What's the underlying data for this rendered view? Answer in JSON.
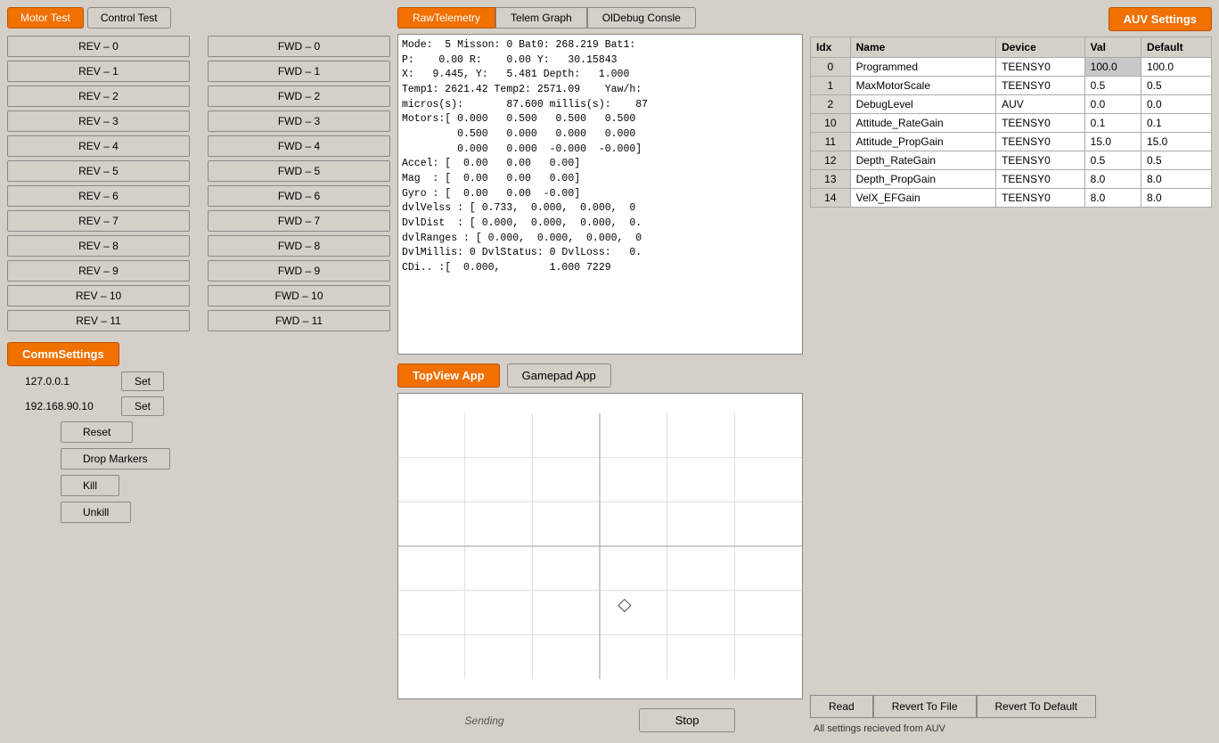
{
  "tabs_left": {
    "motor_test": "Motor Test",
    "control_test": "Control Test"
  },
  "motor_buttons": {
    "rev": [
      "REV – 0",
      "REV – 1",
      "REV – 2",
      "REV – 3",
      "REV – 4",
      "REV – 5",
      "REV – 6",
      "REV – 7",
      "REV – 8",
      "REV – 9",
      "REV – 10",
      "REV – 11"
    ],
    "fwd": [
      "FWD – 0",
      "FWD – 1",
      "FWD – 2",
      "FWD – 3",
      "FWD – 4",
      "FWD – 5",
      "FWD – 6",
      "FWD – 7",
      "FWD – 8",
      "FWD – 9",
      "FWD – 10",
      "FWD – 11"
    ]
  },
  "comm": {
    "label": "CommSettings",
    "ip1": "127.0.0.1",
    "ip2": "192.168.90.10",
    "set1": "Set",
    "set2": "Set",
    "reset": "Reset",
    "drop_markers": "Drop Markers",
    "kill": "Kill",
    "unkill": "Unkill"
  },
  "middle_tabs": {
    "raw_telemetry": "RawTelemetry",
    "telem_graph": "Telem Graph",
    "ol_debug": "OlDebug Consle"
  },
  "telemetry_text": "Mode:  5 Misson: 0 Bat0: 268.219 Bat1: \nP:    0.00 R:    0.00 Y:   30.15843\nX:   9.445, Y:   5.481 Depth:   1.000\nTemp1: 2621.42 Temp2: 2571.09    Yaw/h:\nmicros(s):       87.600 millis(s):    87\nMotors:[ 0.000   0.500   0.500   0.500\n         0.500   0.000   0.000   0.000\n         0.000   0.000  -0.000  -0.000]\nAccel: [  0.00   0.00   0.00]\nMag  : [  0.00   0.00   0.00]\nGyro : [  0.00   0.00  -0.00]\ndvlVelss : [ 0.733,  0.000,  0.000,  0\nDvlDist  : [ 0.000,  0.000,  0.000,  0.\ndvlRanges : [ 0.000,  0.000,  0.000,  0\nDvlMillis: 0 DvlStatus: 0 DvlLoss:   0.\nCDi.. :[  0.000,        1.000 7229",
  "topview": {
    "topview_app": "TopView App",
    "gamepad_app": "Gamepad App"
  },
  "send_stop": {
    "sending": "Sending",
    "stop": "Stop"
  },
  "auv_settings": {
    "label": "AUV Settings",
    "columns": [
      "Idx",
      "Name",
      "Device",
      "Val",
      "Default"
    ],
    "rows": [
      {
        "idx": "0",
        "name": "Programmed",
        "device": "TEENSY0",
        "val": "100.0",
        "default": "100.0",
        "val_highlight": true
      },
      {
        "idx": "1",
        "name": "MaxMotorScale",
        "device": "TEENSY0",
        "val": "0.5",
        "default": "0.5",
        "val_highlight": false
      },
      {
        "idx": "2",
        "name": "DebugLevel",
        "device": "AUV",
        "val": "0.0",
        "default": "0.0",
        "val_highlight": false
      },
      {
        "idx": "10",
        "name": "Attitude_RateGain",
        "device": "TEENSY0",
        "val": "0.1",
        "default": "0.1",
        "val_highlight": false
      },
      {
        "idx": "11",
        "name": "Attitude_PropGain",
        "device": "TEENSY0",
        "val": "15.0",
        "default": "15.0",
        "val_highlight": false
      },
      {
        "idx": "12",
        "name": "Depth_RateGain",
        "device": "TEENSY0",
        "val": "0.5",
        "default": "0.5",
        "val_highlight": false
      },
      {
        "idx": "13",
        "name": "Depth_PropGain",
        "device": "TEENSY0",
        "val": "8.0",
        "default": "8.0",
        "val_highlight": false
      },
      {
        "idx": "14",
        "name": "VelX_EFGain",
        "device": "TEENSY0",
        "val": "8.0",
        "default": "8.0",
        "val_highlight": false
      }
    ],
    "read_btn": "Read",
    "revert_file_btn": "Revert To File",
    "revert_default_btn": "Revert To Default",
    "status_text": "All settings recieved from AUV"
  }
}
